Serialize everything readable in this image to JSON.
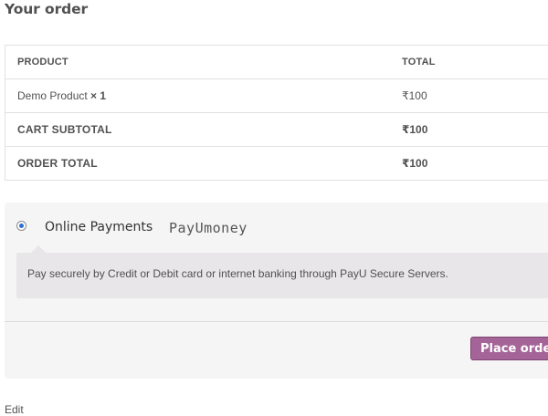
{
  "page": {
    "title": "Your order"
  },
  "order_table": {
    "headers": {
      "product": "PRODUCT",
      "total": "TOTAL"
    },
    "item": {
      "name": "Demo Product",
      "qty_prefix": "×",
      "qty": "1",
      "total": "₹100"
    },
    "subtotal": {
      "label": "CART SUBTOTAL",
      "value": "₹100"
    },
    "order_total": {
      "label": "ORDER TOTAL",
      "value": "₹100"
    }
  },
  "payment": {
    "method_label": "Online Payments",
    "logo_text": "PayUmoney",
    "description": "Pay securely by Credit or Debit card or internet banking through PayU Secure Servers.",
    "selected": true
  },
  "actions": {
    "place_order_label": "Place order"
  },
  "footer": {
    "cutoff_text": "Edit"
  },
  "colors": {
    "accent": "#a46497",
    "radio": "#2c6ed5"
  }
}
